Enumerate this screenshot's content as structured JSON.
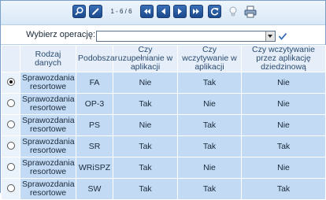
{
  "toolbar": {
    "pager": "1 - 6 / 6",
    "icons": [
      "search-icon",
      "edit-icon",
      "first-page-icon",
      "prev-page-icon",
      "next-page-icon",
      "last-page-icon",
      "refresh-icon",
      "hint-bulb-icon",
      "print-icon"
    ]
  },
  "operation": {
    "label": "Wybierz operację:",
    "selected": ""
  },
  "grid": {
    "headers": [
      "Rodzaj danych",
      "Podobszar",
      "Czy uzupełnianie w aplikacji",
      "Czy wczytywanie w aplikacji",
      "Czy wczytywanie przez aplikację dziedzinową"
    ],
    "rows": [
      {
        "selected": true,
        "type": "Sprawozdania resortowe",
        "sub": "FA",
        "fill": "Nie",
        "load": "Tak",
        "domain": "Nie"
      },
      {
        "selected": false,
        "type": "Sprawozdania resortowe",
        "sub": "OP-3",
        "fill": "Tak",
        "load": "Nie",
        "domain": "Nie"
      },
      {
        "selected": false,
        "type": "Sprawozdania resortowe",
        "sub": "PS",
        "fill": "Nie",
        "load": "Tak",
        "domain": "Nie"
      },
      {
        "selected": false,
        "type": "Sprawozdania resortowe",
        "sub": "SR",
        "fill": "Tak",
        "load": "Tak",
        "domain": "Tak"
      },
      {
        "selected": false,
        "type": "Sprawozdania resortowe",
        "sub": "WRiSPZ",
        "fill": "Tak",
        "load": "Nie",
        "domain": "Nie"
      },
      {
        "selected": false,
        "type": "Sprawozdania resortowe",
        "sub": "SW",
        "fill": "Tak",
        "load": "Tak",
        "domain": "Tak"
      }
    ]
  },
  "colors": {
    "header_bg": "#e6eff9",
    "row_bg": "#c2daf4",
    "toolbar_button": "#1b4a8c"
  }
}
